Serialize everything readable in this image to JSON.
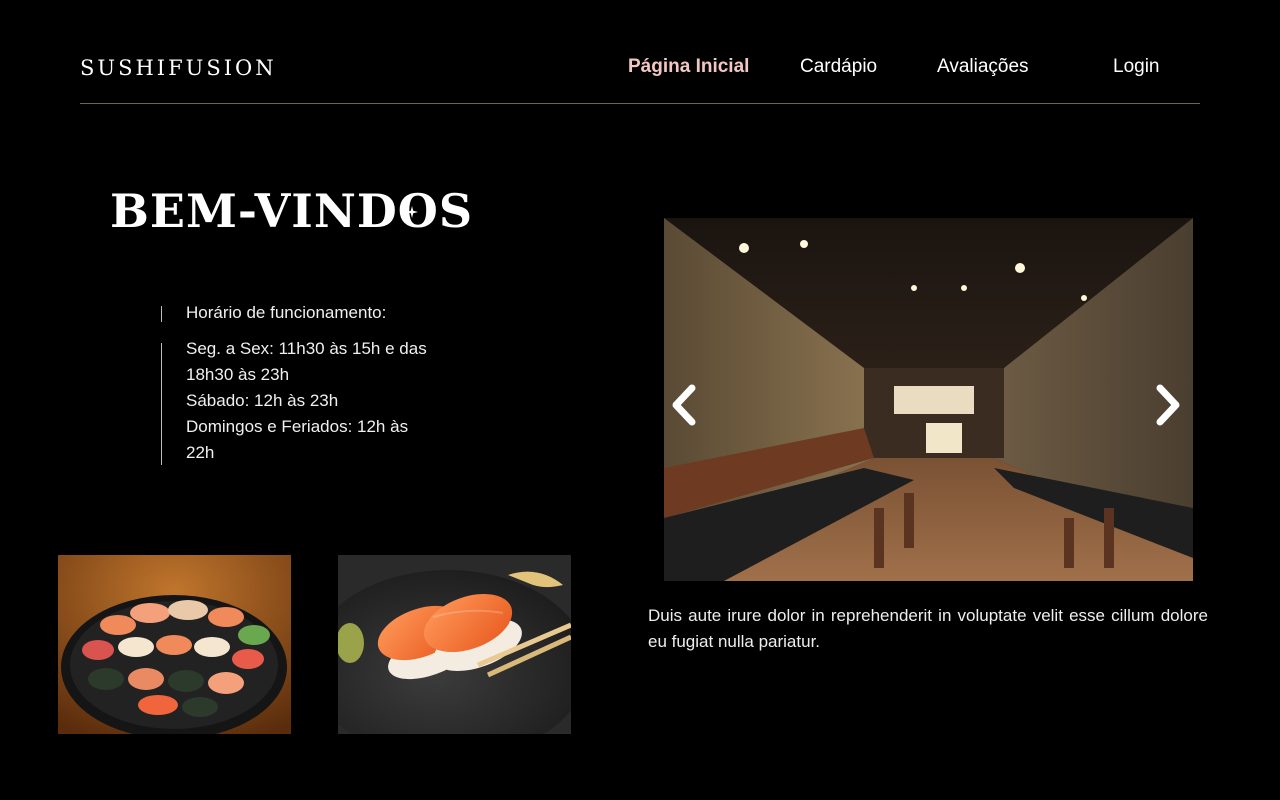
{
  "header": {
    "logo": "SUSHIFUSION",
    "nav": {
      "home": "Página Inicial",
      "menu": "Cardápio",
      "reviews": "Avaliações",
      "login": "Login"
    }
  },
  "hero": {
    "title": "BEM-VINDOS",
    "hours_label": "Horário de funcionamento:",
    "hours_lines": [
      "Seg. a Sex: 11h30 às 15h e das",
      "18h30 às 23h",
      "Sábado: 12h às 23h",
      "Domingos e Feriados: 12h às",
      "22h"
    ]
  },
  "carousel": {
    "caption": "Duis aute irure dolor in reprehenderit in voluptate velit esse cillum dolore eu fugiat nulla pariatur."
  },
  "icons": {
    "prev": "chevron-left-icon",
    "next": "chevron-right-icon",
    "sparkle": "sparkle-icon"
  },
  "colors": {
    "background": "#000000",
    "active_nav": "#f2c6c2",
    "divider": "#6e6255",
    "text": "#ffffff"
  }
}
